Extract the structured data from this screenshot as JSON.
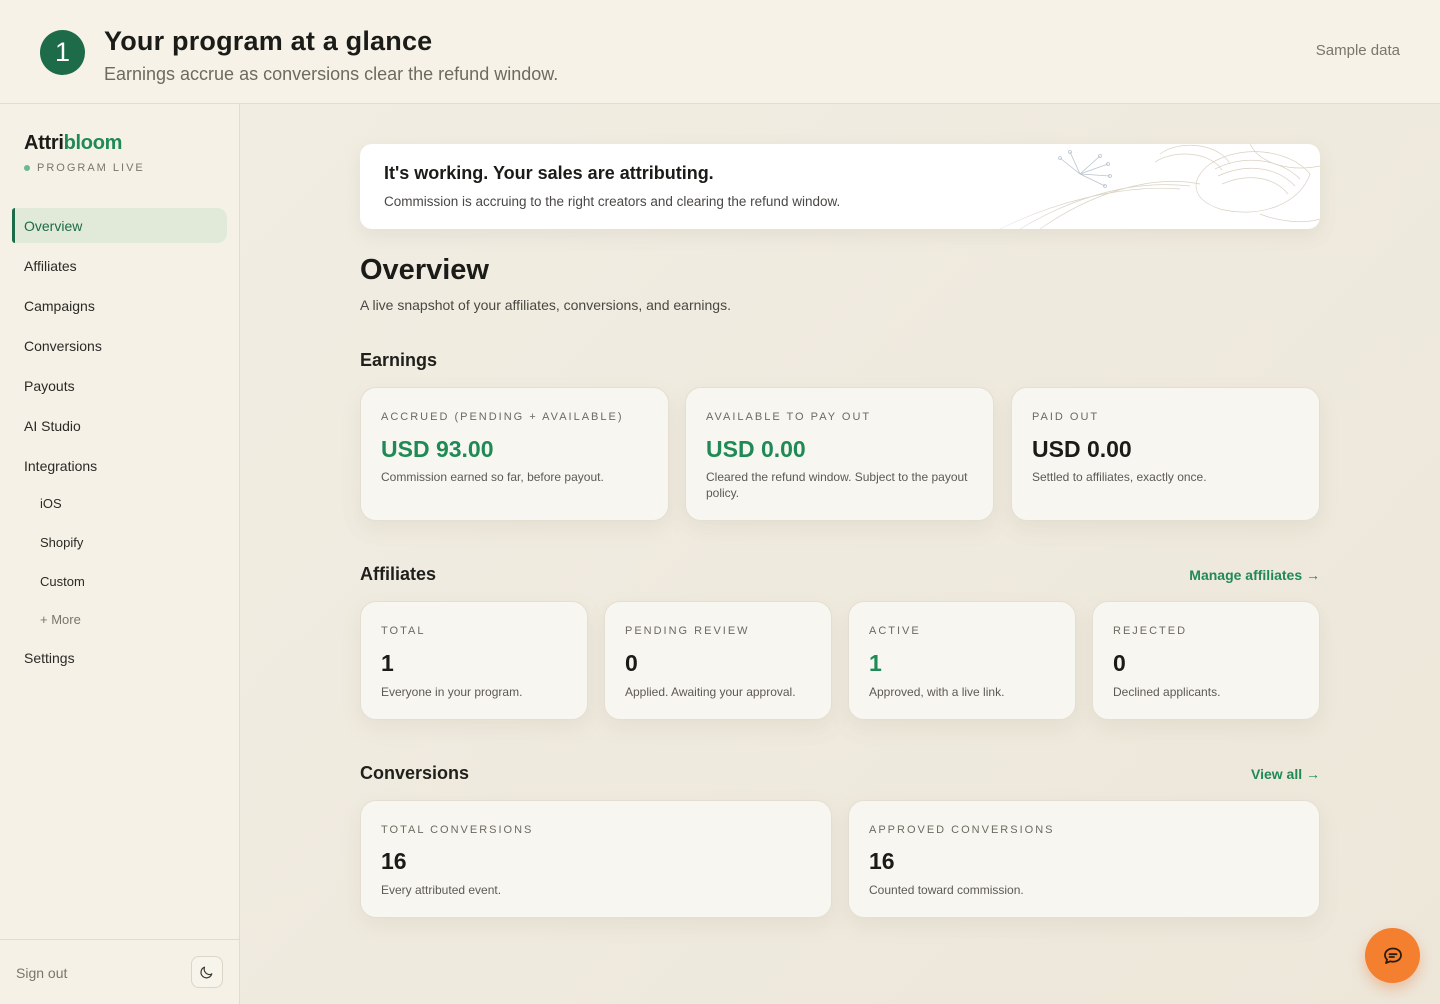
{
  "banner": {
    "step": "1",
    "title": "Your program at a glance",
    "subtitle": "Earnings accrue as conversions clear the refund window.",
    "sample_label": "Sample data"
  },
  "sidebar": {
    "brand_prefix": "Attri",
    "brand_suffix": "bloom",
    "status": "PROGRAM LIVE",
    "items": [
      {
        "label": "Overview"
      },
      {
        "label": "Affiliates"
      },
      {
        "label": "Campaigns"
      },
      {
        "label": "Conversions"
      },
      {
        "label": "Payouts"
      },
      {
        "label": "AI Studio"
      },
      {
        "label": "Integrations"
      },
      {
        "label": "Settings"
      }
    ],
    "integrations": [
      {
        "label": "iOS"
      },
      {
        "label": "Shopify"
      },
      {
        "label": "Custom"
      }
    ],
    "more_label": "+ More",
    "signout_label": "Sign out"
  },
  "hero": {
    "title": "It's working. Your sales are attributing.",
    "subtitle": "Commission is accruing to the right creators and clearing the refund window."
  },
  "page": {
    "title": "Overview",
    "subtitle": "A live snapshot of your affiliates, conversions, and earnings."
  },
  "earnings": {
    "title": "Earnings",
    "cards": [
      {
        "label": "Accrued (pending + available)",
        "value": "USD 93.00",
        "desc": "Commission earned so far, before payout."
      },
      {
        "label": "Available to pay out",
        "value": "USD 0.00",
        "desc": "Cleared the refund window. Subject to the payout policy."
      },
      {
        "label": "Paid out",
        "value": "USD 0.00",
        "desc": "Settled to affiliates, exactly once."
      }
    ]
  },
  "affiliates": {
    "title": "Affiliates",
    "link": "Manage affiliates →",
    "cards": [
      {
        "label": "Total",
        "value": "1",
        "desc": "Everyone in your program."
      },
      {
        "label": "Pending review",
        "value": "0",
        "desc": "Applied. Awaiting your approval."
      },
      {
        "label": "Active",
        "value": "1",
        "desc": "Approved, with a live link."
      },
      {
        "label": "Rejected",
        "value": "0",
        "desc": "Declined applicants."
      }
    ]
  },
  "conversions": {
    "title": "Conversions",
    "link": "View all →",
    "cards": [
      {
        "label": "Total conversions",
        "value": "16",
        "desc": "Every attributed event."
      },
      {
        "label": "Approved conversions",
        "value": "16",
        "desc": "Counted toward commission."
      }
    ]
  },
  "colors": {
    "accent": "#1f8a55",
    "badge": "#1d6b48",
    "chat": "#f47f2f"
  },
  "icons": {
    "theme": "moon-icon",
    "chat": "chat-bubble-icon"
  }
}
